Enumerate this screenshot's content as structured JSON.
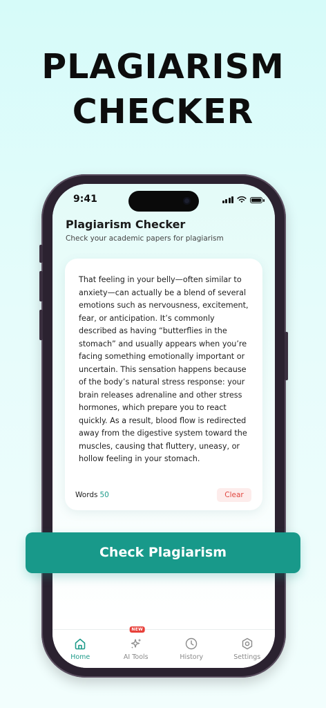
{
  "hero": {
    "line1": "PLAGIARISM",
    "line2": "CHECKER"
  },
  "status_bar": {
    "time": "9:41"
  },
  "header": {
    "title": "Plagiarism Checker",
    "subtitle": "Check your academic papers for plagiarism"
  },
  "editor": {
    "text": "That feeling in your belly—often similar to anxiety—can actually be a blend of several emotions such as nervousness, excitement, fear, or anticipation. It’s commonly described as having “butterflies in the stomach” and usually appears when you’re facing something emotionally important or uncertain. This sensation happens because of the body’s natural stress response: your brain releases adrenaline and other stress hormones, which prepare you to react quickly. As a result, blood flow is redirected away from the digestive system toward the muscles, causing that fluttery, uneasy, or hollow feeling in your stomach.",
    "words_label": "Words",
    "words_count": "50",
    "clear_label": "Clear"
  },
  "cta": {
    "label": "Check Plagiarism"
  },
  "tabs": [
    {
      "label": "Home",
      "icon": "home-icon",
      "active": true
    },
    {
      "label": "AI Tools",
      "icon": "sparkles-icon",
      "badge": "NEW"
    },
    {
      "label": "History",
      "icon": "clock-icon"
    },
    {
      "label": "Settings",
      "icon": "gear-icon"
    }
  ],
  "colors": {
    "accent": "#18998a",
    "accent_text": "#1e9b8a",
    "clear_bg": "#fdeceb",
    "clear_text": "#e0463f",
    "badge": "#e8403a"
  }
}
